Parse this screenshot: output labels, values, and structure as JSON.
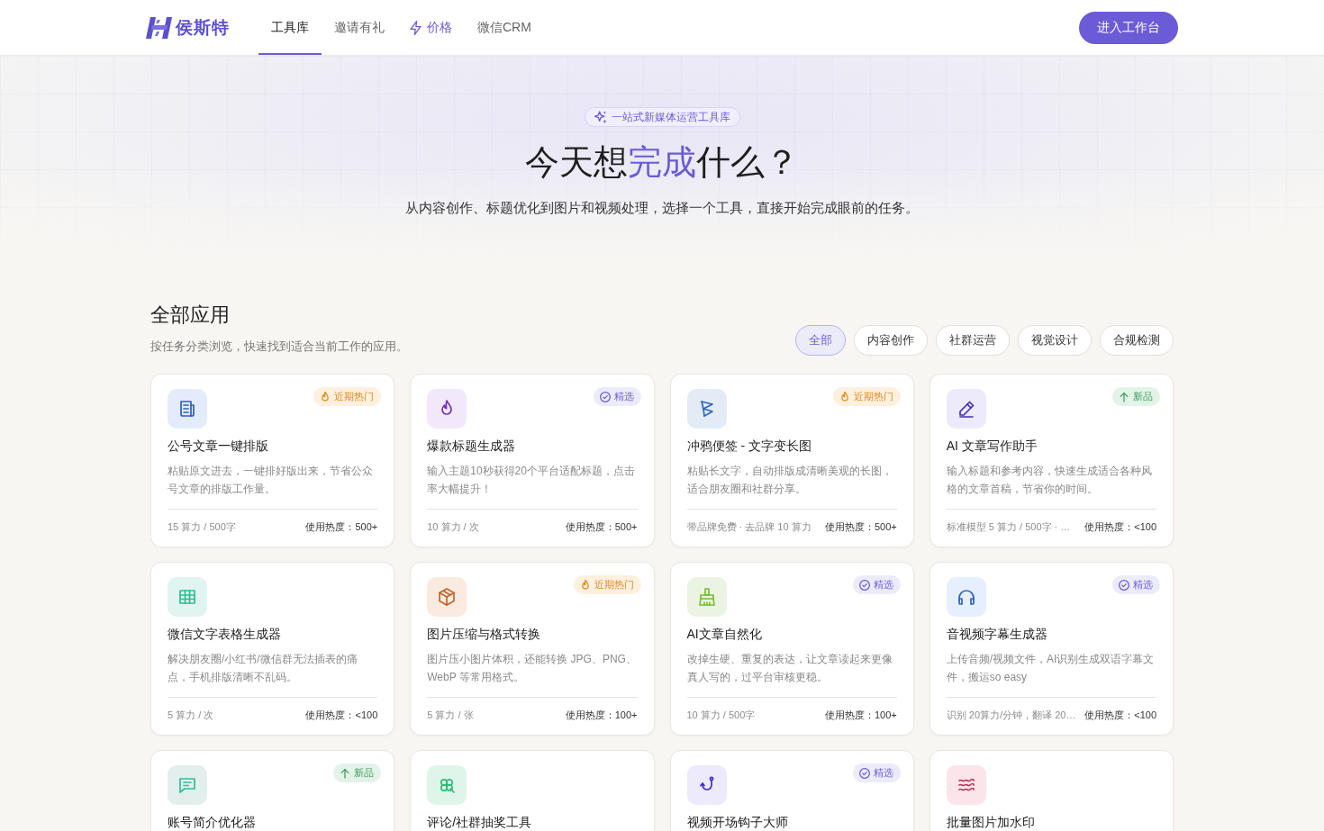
{
  "header": {
    "logo": "侯斯特",
    "nav": [
      {
        "label": "工具库",
        "selected": true,
        "kind": "plain"
      },
      {
        "label": "邀请有礼",
        "selected": false,
        "kind": "plain"
      },
      {
        "label": "价格",
        "selected": false,
        "kind": "accent"
      },
      {
        "label": "微信CRM",
        "selected": false,
        "kind": "plain"
      }
    ],
    "cta": "进入工作台"
  },
  "hero": {
    "badge": "一站式新媒体运营工具库",
    "title": [
      {
        "text": "今天想",
        "accent": false
      },
      {
        "text": "完成",
        "accent": true
      },
      {
        "text": "什么？",
        "accent": false
      }
    ],
    "subtitle": "从内容创作、标题优化到图片和视频处理，选择一个工具，直接开始完成眼前的任务。"
  },
  "section": {
    "title": "全部应用",
    "subtitle": "按任务分类浏览，快速找到适合当前工作的应用。",
    "filters": [
      {
        "label": "全部",
        "selected": true
      },
      {
        "label": "内容创作",
        "selected": false
      },
      {
        "label": "社群运营",
        "selected": false
      },
      {
        "label": "视觉设计",
        "selected": false
      },
      {
        "label": "合规检测",
        "selected": false
      }
    ]
  },
  "tools": [
    {
      "title": "公号文章一键排版",
      "color": "#e4ecfb",
      "badge": {
        "kind": "hot",
        "label": "近期热门"
      },
      "description": "粘贴原文进去，一键排好版出来，节省公众号文章的排版工作量。",
      "cost": "15 算力 / 500字",
      "heat": "使用热度：500+"
    },
    {
      "title": "爆款标题生成器",
      "color": "#f2e8fc",
      "badge": {
        "kind": "featured",
        "label": "精选"
      },
      "description": "输入主题10秒获得20个平台适配标题，点击率大幅提升！",
      "cost": "10 算力 / 次",
      "heat": "使用热度：500+"
    },
    {
      "title": "冲鸦便签 - 文字变长图",
      "color": "#e3ebf7",
      "badge": {
        "kind": "hot",
        "label": "近期热门"
      },
      "description": "粘贴长文字，自动排版成清晰美观的长图，适合朋友圈和社群分享。",
      "cost": "带品牌免费 · 去品牌 10 算力",
      "heat": "使用热度：500+"
    },
    {
      "title": "AI 文章写作助手",
      "color": "#edeafb",
      "badge": {
        "kind": "new",
        "label": "新品"
      },
      "description": "输入标题和参考内容，快速生成适合各种风格的文章首稿，节省你的时间。",
      "cost": "标准模型 5 算力 / 500字 · …",
      "heat": "使用热度：<100"
    },
    {
      "title": "微信文字表格生成器",
      "color": "#e0f5ef",
      "description": "解决朋友圈/小红书/微信群无法插表的痛点，手机排版清晰不乱码。",
      "cost": "5 算力 / 次",
      "heat": "使用热度：<100"
    },
    {
      "title": "图片压缩与格式转换",
      "color": "#fbeadf",
      "badge": {
        "kind": "hot",
        "label": "近期热门"
      },
      "description": "图片压小图片体积，还能转换 JPG、PNG、WebP 等常用格式。",
      "cost": "5 算力 / 张",
      "heat": "使用热度：100+"
    },
    {
      "title": "AI文章自然化",
      "color": "#ebf3e2",
      "badge": {
        "kind": "featured",
        "label": "精选"
      },
      "description": "改掉生硬、重复的表达，让文章读起来更像真人写的，过平台审核更稳。",
      "cost": "10 算力 / 500字",
      "heat": "使用热度：100+"
    },
    {
      "title": "音视频字幕生成器",
      "color": "#e6effd",
      "badge": {
        "kind": "featured",
        "label": "精选"
      },
      "description": "上传音频/视频文件，AI识别生成双语字幕文件，搬运so easy",
      "cost": "识别 20算力/分钟，翻译 20…",
      "heat": "使用热度：<100"
    },
    {
      "title": "账号简介优化器",
      "color": "#e3efec",
      "badge": {
        "kind": "new",
        "label": "新品"
      }
    },
    {
      "title": "评论/社群抽奖工具",
      "color": "#dff5ea"
    },
    {
      "title": "视频开场钩子大师",
      "color": "#eceafc",
      "badge": {
        "kind": "featured",
        "label": "精选"
      }
    },
    {
      "title": "批量图片加水印",
      "color": "#fbe4ea"
    }
  ]
}
